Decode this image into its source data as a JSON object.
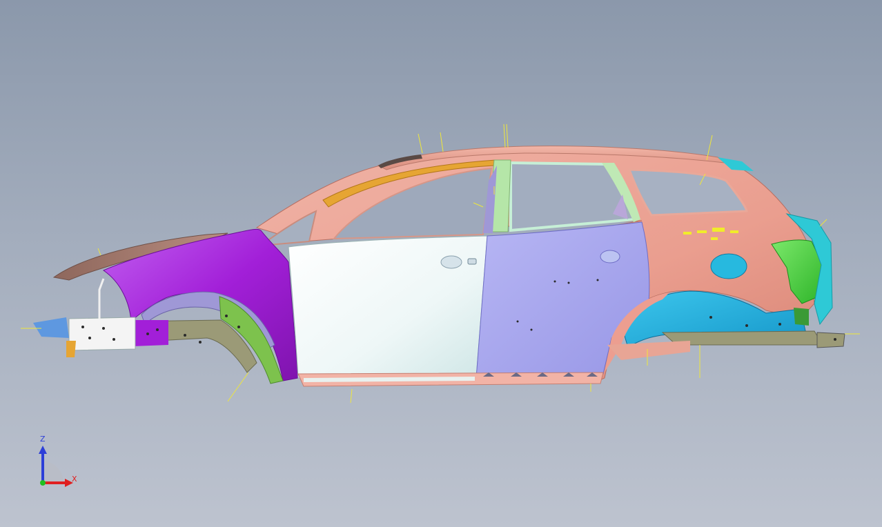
{
  "app": {
    "viewport_background_top": "#8b98ab",
    "viewport_background_bottom": "#bdc3cf"
  },
  "model": {
    "colors": {
      "roof_pink": "#e8a595",
      "front_fender_purple": "#a21fd8",
      "front_door_white": "#e8f4f4",
      "rear_door_lavender": "#a9a8ef",
      "rear_quarter_pink": "#ea9e8f",
      "wheelhouse_cyan": "#23b7e0",
      "taillight_green": "#3fd43a",
      "hood_brown": "#a77e72",
      "rails_olive": "#9b9a77",
      "strut_lavender": "#9f98d6",
      "pillar_gold": "#e6a533",
      "accent_yellow": "#f1ec2a"
    }
  },
  "triad": {
    "z_label": "Z",
    "x_label": "X",
    "z_color": "#2d3fd8",
    "x_color": "#e02020",
    "y_color": "#20c020"
  }
}
